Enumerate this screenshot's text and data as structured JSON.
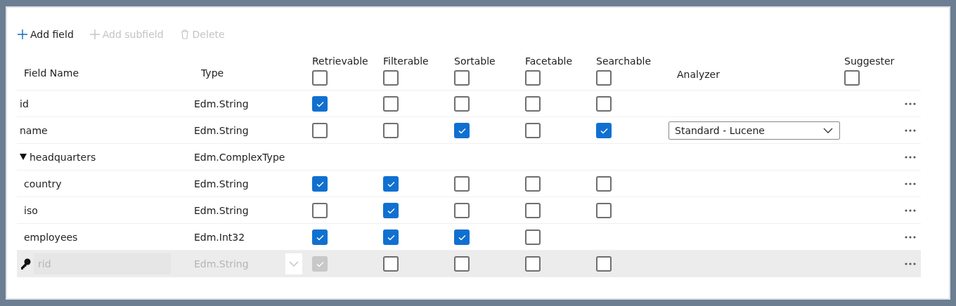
{
  "toolbar": [
    {
      "kind": "add",
      "label": "Add field",
      "disabled": false
    },
    {
      "kind": "add",
      "label": "Add subfield",
      "disabled": true
    },
    {
      "kind": "delete",
      "label": "Delete",
      "disabled": true
    }
  ],
  "columns": [
    {
      "label": "Field Name",
      "kind": "text"
    },
    {
      "label": "Type",
      "kind": "text"
    },
    {
      "label": "Retrievable",
      "kind": "check",
      "checked": false
    },
    {
      "label": "Filterable",
      "kind": "check",
      "checked": false
    },
    {
      "label": "Sortable",
      "kind": "check",
      "checked": false
    },
    {
      "label": "Facetable",
      "kind": "check",
      "checked": false
    },
    {
      "label": "Searchable",
      "kind": "check",
      "checked": false
    },
    {
      "label": "Analyzer",
      "kind": "text"
    },
    {
      "label": "Suggester",
      "kind": "check",
      "checked": false
    }
  ],
  "fields": [
    {
      "kind": "text",
      "name": "id",
      "type": "Edm.String",
      "selected": false,
      "key": false,
      "checks": [
        true,
        false,
        false,
        false,
        false
      ]
    },
    {
      "kind": "text",
      "name": "name",
      "type": "Edm.String",
      "selected": false,
      "key": false,
      "checks": [
        false,
        false,
        true,
        false,
        true
      ],
      "analyzer": "Standard - Lucene"
    },
    {
      "kind": "text",
      "name": "headquarters",
      "type": "Edm.ComplexType",
      "selected": false,
      "key": false,
      "expanded": true,
      "children": [
        {
          "kind": "text",
          "name": "country",
          "type": "Edm.String",
          "selected": false,
          "key": false,
          "checks": [
            true,
            true,
            false,
            false,
            false
          ]
        },
        {
          "kind": "text",
          "name": "iso",
          "type": "Edm.String",
          "selected": false,
          "key": false,
          "checks": [
            false,
            true,
            false,
            false,
            false
          ]
        },
        {
          "kind": "text",
          "name": "employees",
          "type": "Edm.Int32",
          "selected": false,
          "key": false,
          "checks": [
            true,
            true,
            true,
            false
          ]
        }
      ]
    },
    {
      "kind": "input",
      "key": true,
      "name": "rid",
      "type": "Edm.String",
      "selected": true,
      "checks": [
        true,
        false,
        false,
        false,
        false
      ]
    }
  ]
}
